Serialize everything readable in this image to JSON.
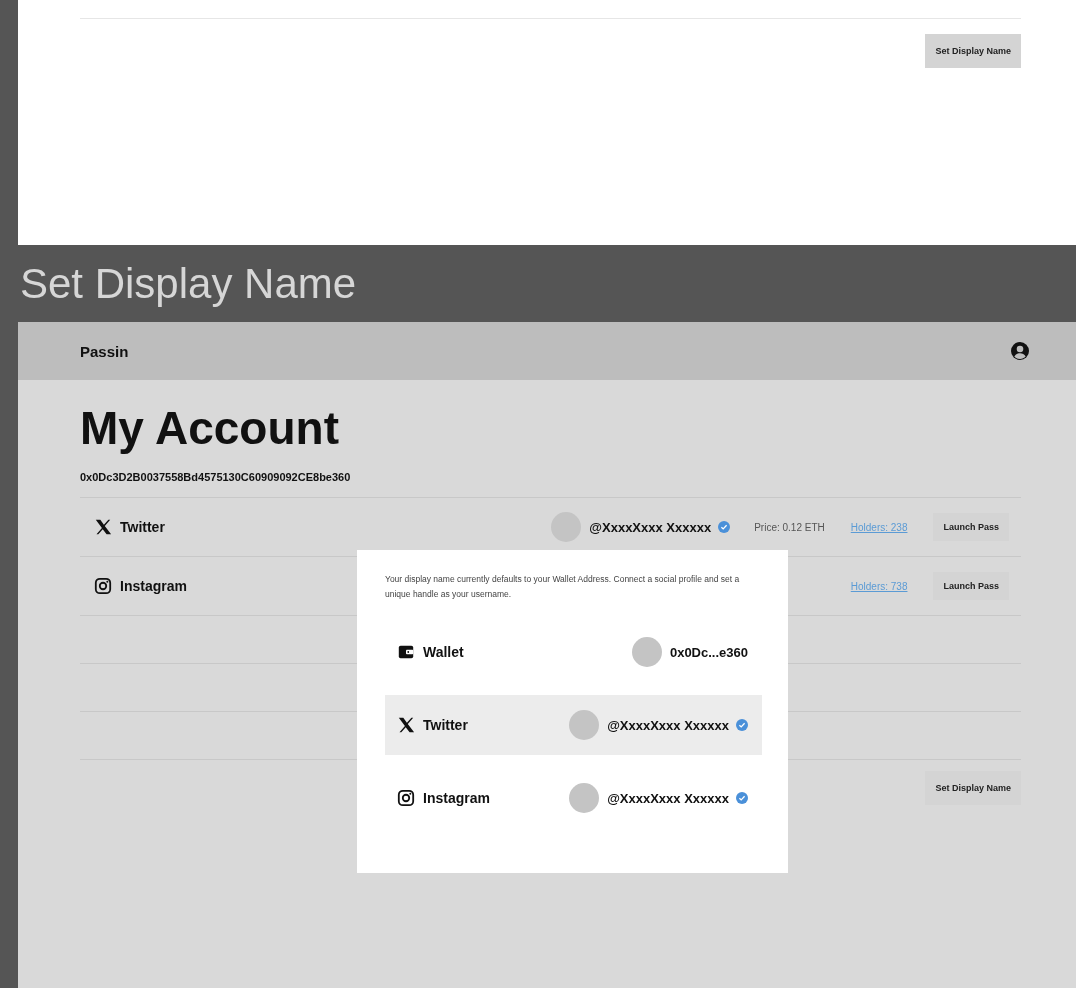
{
  "top_panel": {
    "button": "Set Display Name"
  },
  "section_title": "Set Display Name",
  "app": {
    "brand": "Passin",
    "title": "My Account",
    "address": "0x0Dc3D2B0037558Bd4575130C60909092CE8be360",
    "accounts": [
      {
        "kind": "twitter",
        "label": "Twitter",
        "handle": "@XxxxXxxx Xxxxxx",
        "verified": true,
        "price": "Price: 0.12 ETH",
        "holders": "Holders: 238",
        "action": "Launch Pass"
      },
      {
        "kind": "instagram",
        "label": "Instagram",
        "holders": "Holders: 738",
        "action": "Launch Pass"
      }
    ],
    "button": "Set Display Name"
  },
  "modal": {
    "message": "Your display name currently defaults to your Wallet Address. Connect a social profile and set a unique handle as your username.",
    "options": [
      {
        "kind": "wallet",
        "label": "Wallet",
        "value": "0x0Dc...e360",
        "verified": false,
        "selected": false
      },
      {
        "kind": "twitter",
        "label": "Twitter",
        "value": "@XxxxXxxx Xxxxxx",
        "verified": true,
        "selected": true
      },
      {
        "kind": "instagram",
        "label": "Instagram",
        "value": "@XxxxXxxx Xxxxxx",
        "verified": true,
        "selected": false
      }
    ]
  }
}
